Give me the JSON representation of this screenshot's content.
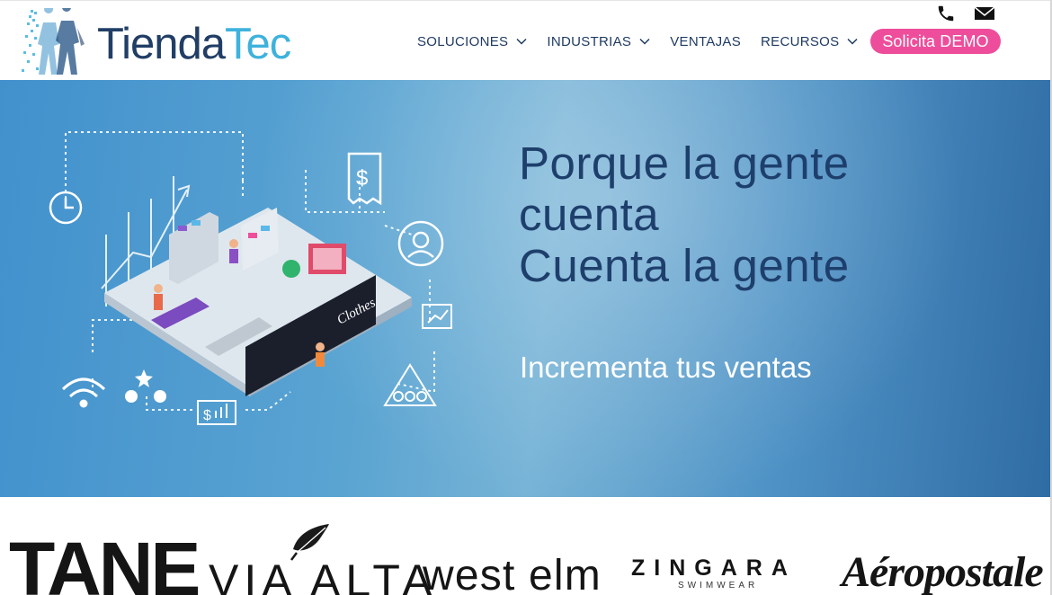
{
  "header": {
    "logo": {
      "part1": "Tienda",
      "part2": "Tec",
      "color_dark": "#213e66",
      "color_light": "#3eb2dc"
    },
    "top_icons": [
      "phone-icon",
      "mail-icon"
    ],
    "nav": {
      "items": [
        {
          "label": "SOLUCIONES",
          "has_dropdown": true
        },
        {
          "label": "INDUSTRIAS",
          "has_dropdown": true
        },
        {
          "label": "VENTAJAS",
          "has_dropdown": false
        },
        {
          "label": "RECURSOS",
          "has_dropdown": true
        }
      ]
    },
    "cta": {
      "label": "Solicita DEMO",
      "color": "#ee4d9b"
    }
  },
  "hero": {
    "headline": [
      "Porque la gente",
      "cuenta",
      "Cuenta la gente"
    ],
    "subheadline": "Incrementa tus ventas",
    "headline_color": "#1e3f6c",
    "illustration_store_sign": "Clothes"
  },
  "brands": {
    "tane": "TANE",
    "via_alta": "VIA ALTA",
    "west_elm": "west elm",
    "zingara": "ZINGARA",
    "zingara_sub": "SWIMWEAR",
    "aeropostale": "Aéropostale"
  }
}
